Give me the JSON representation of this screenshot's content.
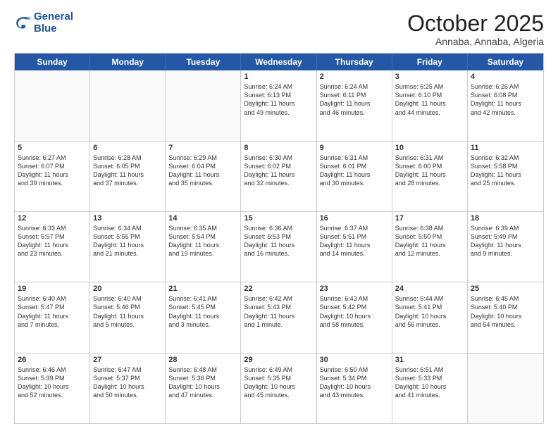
{
  "logo": {
    "line1": "General",
    "line2": "Blue"
  },
  "header": {
    "month": "October 2025",
    "location": "Annaba, Annaba, Algeria"
  },
  "day_headers": [
    "Sunday",
    "Monday",
    "Tuesday",
    "Wednesday",
    "Thursday",
    "Friday",
    "Saturday"
  ],
  "weeks": [
    [
      {
        "day": "",
        "info": ""
      },
      {
        "day": "",
        "info": ""
      },
      {
        "day": "",
        "info": ""
      },
      {
        "day": "1",
        "info": "Sunrise: 6:24 AM\nSunset: 6:13 PM\nDaylight: 11 hours\nand 49 minutes."
      },
      {
        "day": "2",
        "info": "Sunrise: 6:24 AM\nSunset: 6:11 PM\nDaylight: 11 hours\nand 46 minutes."
      },
      {
        "day": "3",
        "info": "Sunrise: 6:25 AM\nSunset: 6:10 PM\nDaylight: 11 hours\nand 44 minutes."
      },
      {
        "day": "4",
        "info": "Sunrise: 6:26 AM\nSunset: 6:08 PM\nDaylight: 11 hours\nand 42 minutes."
      }
    ],
    [
      {
        "day": "5",
        "info": "Sunrise: 6:27 AM\nSunset: 6:07 PM\nDaylight: 11 hours\nand 39 minutes."
      },
      {
        "day": "6",
        "info": "Sunrise: 6:28 AM\nSunset: 6:05 PM\nDaylight: 11 hours\nand 37 minutes."
      },
      {
        "day": "7",
        "info": "Sunrise: 6:29 AM\nSunset: 6:04 PM\nDaylight: 11 hours\nand 35 minutes."
      },
      {
        "day": "8",
        "info": "Sunrise: 6:30 AM\nSunset: 6:02 PM\nDaylight: 11 hours\nand 32 minutes."
      },
      {
        "day": "9",
        "info": "Sunrise: 6:31 AM\nSunset: 6:01 PM\nDaylight: 11 hours\nand 30 minutes."
      },
      {
        "day": "10",
        "info": "Sunrise: 6:31 AM\nSunset: 6:00 PM\nDaylight: 11 hours\nand 28 minutes."
      },
      {
        "day": "11",
        "info": "Sunrise: 6:32 AM\nSunset: 5:58 PM\nDaylight: 11 hours\nand 25 minutes."
      }
    ],
    [
      {
        "day": "12",
        "info": "Sunrise: 6:33 AM\nSunset: 5:57 PM\nDaylight: 11 hours\nand 23 minutes."
      },
      {
        "day": "13",
        "info": "Sunrise: 6:34 AM\nSunset: 5:55 PM\nDaylight: 11 hours\nand 21 minutes."
      },
      {
        "day": "14",
        "info": "Sunrise: 6:35 AM\nSunset: 5:54 PM\nDaylight: 11 hours\nand 19 minutes."
      },
      {
        "day": "15",
        "info": "Sunrise: 6:36 AM\nSunset: 5:53 PM\nDaylight: 11 hours\nand 16 minutes."
      },
      {
        "day": "16",
        "info": "Sunrise: 6:37 AM\nSunset: 5:51 PM\nDaylight: 11 hours\nand 14 minutes."
      },
      {
        "day": "17",
        "info": "Sunrise: 6:38 AM\nSunset: 5:50 PM\nDaylight: 11 hours\nand 12 minutes."
      },
      {
        "day": "18",
        "info": "Sunrise: 6:39 AM\nSunset: 5:49 PM\nDaylight: 11 hours\nand 9 minutes."
      }
    ],
    [
      {
        "day": "19",
        "info": "Sunrise: 6:40 AM\nSunset: 5:47 PM\nDaylight: 11 hours\nand 7 minutes."
      },
      {
        "day": "20",
        "info": "Sunrise: 6:40 AM\nSunset: 5:46 PM\nDaylight: 11 hours\nand 5 minutes."
      },
      {
        "day": "21",
        "info": "Sunrise: 6:41 AM\nSunset: 5:45 PM\nDaylight: 11 hours\nand 3 minutes."
      },
      {
        "day": "22",
        "info": "Sunrise: 6:42 AM\nSunset: 5:43 PM\nDaylight: 11 hours\nand 1 minute."
      },
      {
        "day": "23",
        "info": "Sunrise: 6:43 AM\nSunset: 5:42 PM\nDaylight: 10 hours\nand 58 minutes."
      },
      {
        "day": "24",
        "info": "Sunrise: 6:44 AM\nSunset: 5:41 PM\nDaylight: 10 hours\nand 56 minutes."
      },
      {
        "day": "25",
        "info": "Sunrise: 6:45 AM\nSunset: 5:40 PM\nDaylight: 10 hours\nand 54 minutes."
      }
    ],
    [
      {
        "day": "26",
        "info": "Sunrise: 6:46 AM\nSunset: 5:39 PM\nDaylight: 10 hours\nand 52 minutes."
      },
      {
        "day": "27",
        "info": "Sunrise: 6:47 AM\nSunset: 5:37 PM\nDaylight: 10 hours\nand 50 minutes."
      },
      {
        "day": "28",
        "info": "Sunrise: 6:48 AM\nSunset: 5:36 PM\nDaylight: 10 hours\nand 47 minutes."
      },
      {
        "day": "29",
        "info": "Sunrise: 6:49 AM\nSunset: 5:35 PM\nDaylight: 10 hours\nand 45 minutes."
      },
      {
        "day": "30",
        "info": "Sunrise: 6:50 AM\nSunset: 5:34 PM\nDaylight: 10 hours\nand 43 minutes."
      },
      {
        "day": "31",
        "info": "Sunrise: 6:51 AM\nSunset: 5:33 PM\nDaylight: 10 hours\nand 41 minutes."
      },
      {
        "day": "",
        "info": ""
      }
    ]
  ]
}
